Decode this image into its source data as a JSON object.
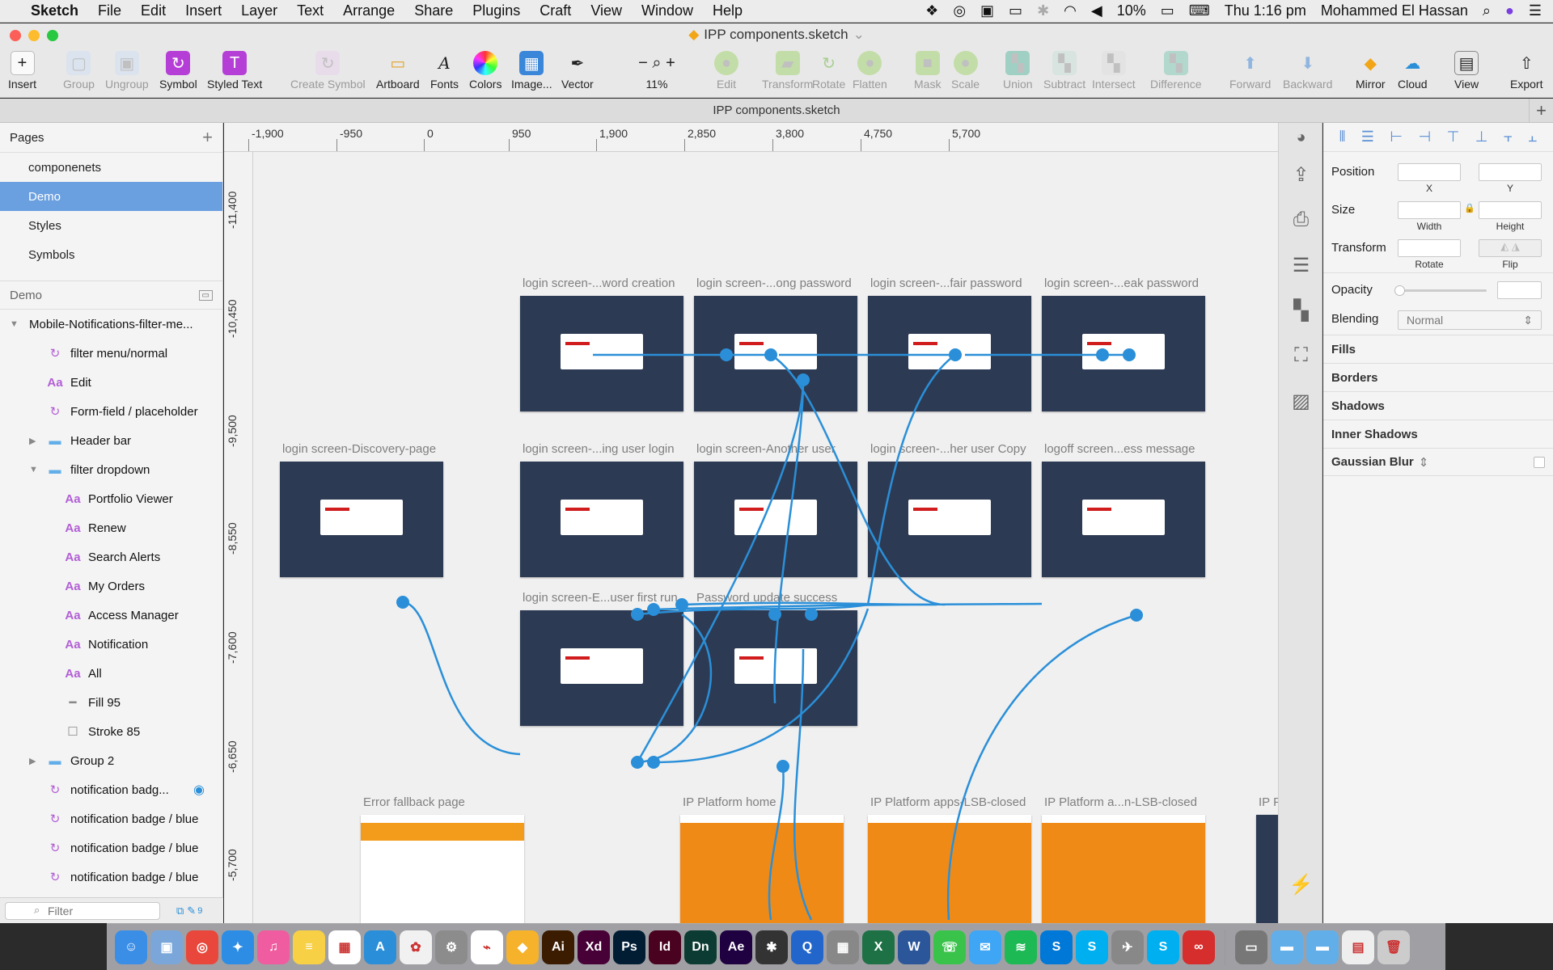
{
  "menubar": {
    "items": [
      "Sketch",
      "File",
      "Edit",
      "Insert",
      "Layer",
      "Text",
      "Arrange",
      "Share",
      "Plugins",
      "Craft",
      "View",
      "Window",
      "Help"
    ],
    "battery": "10%",
    "clock": "Thu 1:16 pm",
    "user": "Mohammed El Hassan"
  },
  "window": {
    "title": "IPP components.sketch",
    "doc_tab": "IPP components.sketch"
  },
  "toolbar": {
    "insert": "Insert",
    "group": "Group",
    "ungroup": "Ungroup",
    "symbol": "Symbol",
    "styled_text": "Styled Text",
    "create_symbol": "Create Symbol",
    "artboard": "Artboard",
    "fonts": "Fonts",
    "colors": "Colors",
    "image": "Image...",
    "vector": "Vector",
    "zoom": "11%",
    "edit": "Edit",
    "transform": "Transform",
    "rotate": "Rotate",
    "flatten": "Flatten",
    "mask": "Mask",
    "scale": "Scale",
    "union": "Union",
    "subtract": "Subtract",
    "intersect": "Intersect",
    "difference": "Difference",
    "forward": "Forward",
    "backward": "Backward",
    "mirror": "Mirror",
    "cloud": "Cloud",
    "view": "View",
    "export": "Export"
  },
  "sidebar": {
    "pages_title": "Pages",
    "pages": [
      "componenets",
      "Demo",
      "Styles",
      "Symbols"
    ],
    "selected_page": "Demo",
    "layers_title": "Demo",
    "layers": [
      {
        "label": "Mobile-Notifications-filter-me...",
        "icon": "disclosure-open",
        "indent": 0
      },
      {
        "label": "filter menu/normal",
        "icon": "symbol",
        "indent": 1
      },
      {
        "label": "Edit",
        "icon": "text",
        "indent": 1
      },
      {
        "label": "Form-field / placeholder",
        "icon": "symbol",
        "indent": 1
      },
      {
        "label": "Header bar",
        "icon": "folder",
        "indent": 1
      },
      {
        "label": "filter dropdown",
        "icon": "folder",
        "indent": 1
      },
      {
        "label": "Portfolio Viewer",
        "icon": "text",
        "indent": 2
      },
      {
        "label": "Renew",
        "icon": "text",
        "indent": 2
      },
      {
        "label": "Search Alerts",
        "icon": "text",
        "indent": 2
      },
      {
        "label": "My Orders",
        "icon": "text",
        "indent": 2
      },
      {
        "label": "Access Manager",
        "icon": "text",
        "indent": 2
      },
      {
        "label": "Notification",
        "icon": "text",
        "indent": 2
      },
      {
        "label": "All",
        "icon": "text",
        "indent": 2
      },
      {
        "label": "Fill 95",
        "icon": "line",
        "indent": 2
      },
      {
        "label": "Stroke 85",
        "icon": "rect",
        "indent": 2
      },
      {
        "label": "Group 2",
        "icon": "folder",
        "indent": 1
      },
      {
        "label": "notification badg...",
        "icon": "symbol",
        "indent": 1
      },
      {
        "label": "notification badge / blue",
        "icon": "symbol",
        "indent": 1
      },
      {
        "label": "notification badge / blue",
        "icon": "symbol",
        "indent": 1
      },
      {
        "label": "notification badge / blue",
        "icon": "symbol",
        "indent": 1
      }
    ],
    "filter_placeholder": "Filter",
    "filter_count": "9"
  },
  "rulers": {
    "top": [
      "-1,900",
      "-950",
      "0",
      "950",
      "1,900",
      "2,850",
      "3,800",
      "4,750",
      "5,700"
    ],
    "left": [
      "-11,400",
      "-10,450",
      "-9,500",
      "-8,550",
      "-7,600",
      "-6,650",
      "-5,700"
    ]
  },
  "canvas": {
    "artboards": [
      "login screen-...word creation",
      "login screen-...ong password",
      "login screen-...fair password",
      "login screen-...eak password",
      "login screen-Discovery-page",
      "login screen-...ing user login",
      "login screen-Another user",
      "login screen-...her user Copy",
      "logoff screen...ess message",
      "login screen-E...user first run",
      "Password update success",
      "Error fallback page",
      "IP Platform home",
      "IP Platform apps-LSB-closed",
      "IP Platform a...n-LSB-closed",
      "IP P"
    ]
  },
  "inspector": {
    "position": "Position",
    "x": "X",
    "y": "Y",
    "size": "Size",
    "width": "Width",
    "height": "Height",
    "transform": "Transform",
    "rotate": "Rotate",
    "flip": "Flip",
    "opacity": "Opacity",
    "blending": "Blending",
    "blending_value": "Normal",
    "sections": [
      "Fills",
      "Borders",
      "Shadows",
      "Inner Shadows",
      "Gaussian Blur"
    ]
  },
  "colors": {
    "accent": "#6a9fe0",
    "flow": "#2a8fd8",
    "artboard_dark": "#2d3a53"
  }
}
